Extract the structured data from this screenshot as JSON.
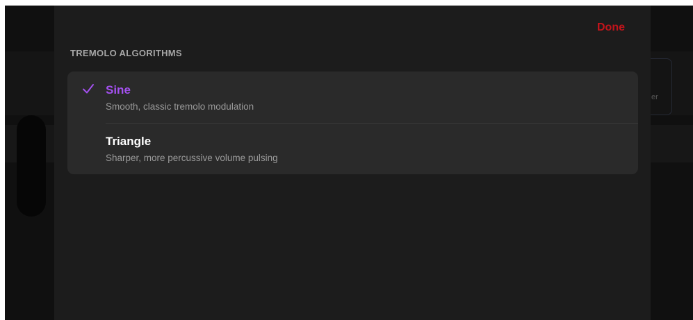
{
  "background": {
    "partial_text": "er"
  },
  "sheet": {
    "done_label": "Done",
    "section_header": "TREMOLO ALGORITHMS",
    "options": [
      {
        "title": "Sine",
        "description": "Smooth, classic tremolo modulation",
        "selected": true
      },
      {
        "title": "Triangle",
        "description": "Sharper, more percussive volume pulsing",
        "selected": false
      }
    ]
  },
  "colors": {
    "accent": "#a451f0",
    "done": "#c4141b",
    "sheet_bg": "#1c1c1c",
    "card_bg": "#2a2a2a"
  },
  "icons": {
    "selected_marker": "checkmark-icon"
  }
}
